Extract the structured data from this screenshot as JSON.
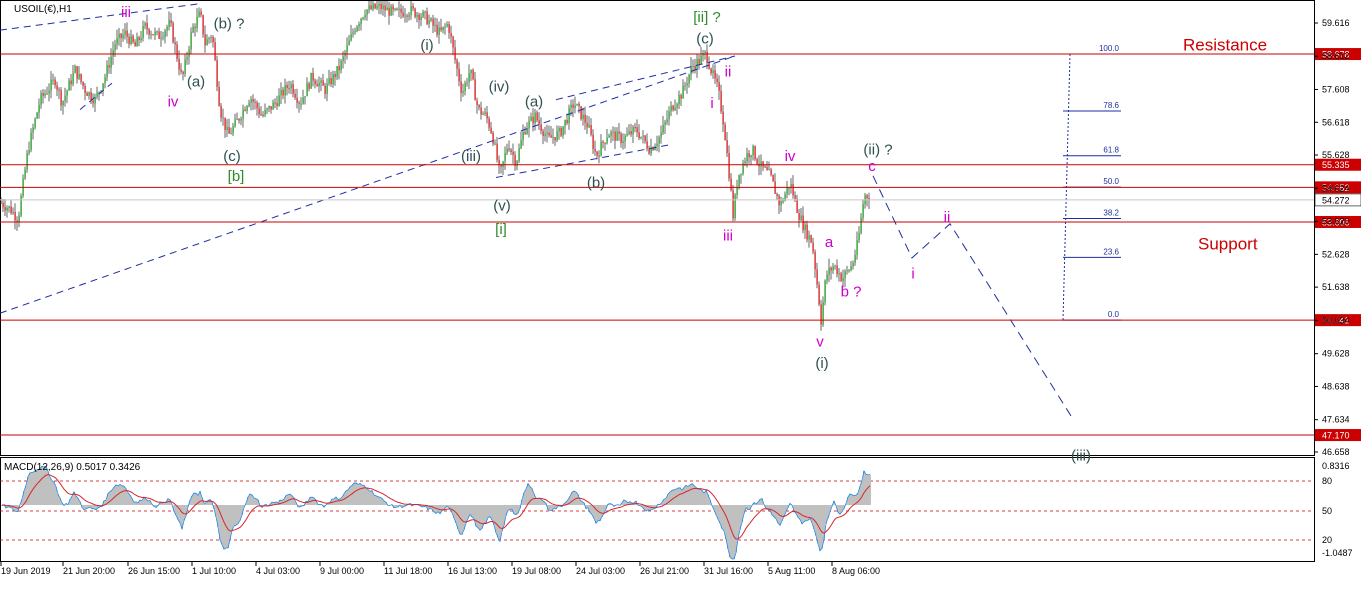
{
  "chart_data": {
    "type": "candlestick",
    "title": "USOIL(€),H1",
    "symbol": "USOIL",
    "timeframe": "H1",
    "price_axis": {
      "ylim": [
        46.658,
        60.0
      ],
      "ticks": [
        59.616,
        58.612,
        57.608,
        56.618,
        55.628,
        54.624,
        53.62,
        52.628,
        51.638,
        50.634,
        49.628,
        48.638,
        47.634,
        46.658
      ]
    },
    "time_axis": {
      "labels": [
        "19 Jun 2019",
        "21 Jun 20:00",
        "26 Jun 15:00",
        "1 Jul 10:00",
        "4 Jul 03:00",
        "9 Jul 00:00",
        "11 Jul 18:00",
        "16 Jul 13:00",
        "19 Jul 08:00",
        "24 Jul 03:00",
        "26 Jul 21:00",
        "31 Jul 16:00",
        "5 Aug 11:00",
        "8 Aug 06:00"
      ]
    },
    "horizontal_levels": [
      {
        "price": 58.678,
        "label": "58.678"
      },
      {
        "price": 55.335,
        "label": "55.335"
      },
      {
        "price": 54.652,
        "label": "54.652"
      },
      {
        "price": 53.606,
        "label": "53.606"
      },
      {
        "price": 50.641,
        "label": "50.641"
      },
      {
        "price": 47.17,
        "label": "47.170"
      }
    ],
    "current_price": {
      "price": 54.272,
      "label": "54.272"
    },
    "zone_labels": [
      {
        "text": "Resistance",
        "price": 58.9
      },
      {
        "text": "Support",
        "price": 52.9
      }
    ],
    "fibonacci": {
      "high": 58.678,
      "low": 50.641,
      "levels": [
        {
          "ratio": 100.0,
          "label": "100.0"
        },
        {
          "ratio": 78.6,
          "label": "78.6"
        },
        {
          "ratio": 61.8,
          "label": "61.8"
        },
        {
          "ratio": 50.0,
          "label": "50.0"
        },
        {
          "ratio": 38.2,
          "label": "38.2"
        },
        {
          "ratio": 23.6,
          "label": "23.6"
        },
        {
          "ratio": 0.0,
          "label": "0.0"
        }
      ]
    },
    "price_path": [
      [
        0,
        54.2
      ],
      [
        10,
        54.0
      ],
      [
        18,
        53.7
      ],
      [
        28,
        55.8
      ],
      [
        40,
        57.3
      ],
      [
        55,
        57.9
      ],
      [
        62,
        57.2
      ],
      [
        75,
        58.2
      ],
      [
        85,
        57.6
      ],
      [
        95,
        57.3
      ],
      [
        105,
        58.0
      ],
      [
        115,
        59.0
      ],
      [
        125,
        59.3
      ],
      [
        135,
        58.9
      ],
      [
        145,
        59.5
      ],
      [
        158,
        59.2
      ],
      [
        170,
        59.6
      ],
      [
        182,
        57.9
      ],
      [
        192,
        59.4
      ],
      [
        200,
        59.9
      ],
      [
        205,
        59.0
      ],
      [
        212,
        59.3
      ],
      [
        220,
        57.0
      ],
      [
        228,
        56.2
      ],
      [
        238,
        56.7
      ],
      [
        250,
        57.4
      ],
      [
        262,
        56.8
      ],
      [
        275,
        57.2
      ],
      [
        290,
        57.8
      ],
      [
        300,
        57.2
      ],
      [
        312,
        58.0
      ],
      [
        325,
        57.6
      ],
      [
        340,
        58.3
      ],
      [
        355,
        59.5
      ],
      [
        365,
        60.0
      ],
      [
        380,
        60.1
      ],
      [
        395,
        59.9
      ],
      [
        410,
        60.0
      ],
      [
        425,
        59.8
      ],
      [
        440,
        59.3
      ],
      [
        448,
        59.6
      ],
      [
        455,
        58.5
      ],
      [
        462,
        57.5
      ],
      [
        470,
        58.2
      ],
      [
        478,
        57.0
      ],
      [
        486,
        56.8
      ],
      [
        492,
        56.3
      ],
      [
        500,
        55.0
      ],
      [
        508,
        56.0
      ],
      [
        516,
        55.4
      ],
      [
        524,
        56.4
      ],
      [
        535,
        56.8
      ],
      [
        548,
        56.1
      ],
      [
        560,
        56.3
      ],
      [
        574,
        57.2
      ],
      [
        588,
        56.5
      ],
      [
        596,
        55.6
      ],
      [
        608,
        56.3
      ],
      [
        622,
        56.1
      ],
      [
        636,
        56.4
      ],
      [
        650,
        55.8
      ],
      [
        660,
        56.2
      ],
      [
        672,
        57.1
      ],
      [
        682,
        57.5
      ],
      [
        692,
        58.3
      ],
      [
        700,
        58.5
      ],
      [
        706,
        58.7
      ],
      [
        712,
        58.1
      ],
      [
        718,
        57.6
      ],
      [
        724,
        56.5
      ],
      [
        730,
        54.8
      ],
      [
        733,
        53.8
      ],
      [
        738,
        55.0
      ],
      [
        746,
        55.6
      ],
      [
        752,
        55.8
      ],
      [
        760,
        55.3
      ],
      [
        770,
        55.0
      ],
      [
        780,
        54.1
      ],
      [
        790,
        54.8
      ],
      [
        798,
        53.9
      ],
      [
        806,
        53.3
      ],
      [
        812,
        53.0
      ],
      [
        818,
        51.5
      ],
      [
        821,
        50.641
      ],
      [
        826,
        52.0
      ],
      [
        834,
        52.3
      ],
      [
        842,
        51.9
      ],
      [
        852,
        52.3
      ],
      [
        858,
        53.0
      ],
      [
        864,
        54.4
      ],
      [
        870,
        54.4
      ]
    ],
    "wave_labels": [
      {
        "text": "iii",
        "x": 126,
        "price": 59.95,
        "color": "#cc00cc"
      },
      {
        "text": "iv",
        "x": 173,
        "price": 57.25,
        "color": "#cc00cc"
      },
      {
        "text": "(a)",
        "x": 196,
        "price": 57.85,
        "color": "#2f4f4f"
      },
      {
        "text": "(b) ?",
        "x": 229,
        "price": 59.6,
        "color": "#2f4f4f"
      },
      {
        "text": "(c)",
        "x": 232,
        "price": 55.6,
        "color": "#2f4f4f"
      },
      {
        "text": "[b]",
        "x": 236,
        "price": 55.0,
        "color": "#2e8b2e"
      },
      {
        "text": "(i)",
        "x": 427,
        "price": 58.95,
        "color": "#2f4f4f"
      },
      {
        "text": "(iv)",
        "x": 499,
        "price": 57.7,
        "color": "#2f4f4f"
      },
      {
        "text": "(a)",
        "x": 534,
        "price": 57.25,
        "color": "#2f4f4f"
      },
      {
        "text": "(iii)",
        "x": 471,
        "price": 55.6,
        "color": "#2f4f4f"
      },
      {
        "text": "(b)",
        "x": 596,
        "price": 54.8,
        "color": "#2f4f4f"
      },
      {
        "text": "(v)",
        "x": 502,
        "price": 54.1,
        "color": "#2f4f4f"
      },
      {
        "text": "[i]",
        "x": 501,
        "price": 53.4,
        "color": "#2e8b2e"
      },
      {
        "text": "[ii] ?",
        "x": 707,
        "price": 59.8,
        "color": "#2e8b2e"
      },
      {
        "text": "(c)",
        "x": 705,
        "price": 59.15,
        "color": "#2f4f4f"
      },
      {
        "text": "ii",
        "x": 728,
        "price": 58.15,
        "color": "#cc00cc"
      },
      {
        "text": "i",
        "x": 712,
        "price": 57.2,
        "color": "#cc00cc"
      },
      {
        "text": "iv",
        "x": 790,
        "price": 55.6,
        "color": "#cc00cc"
      },
      {
        "text": "(ii) ?",
        "x": 878,
        "price": 55.8,
        "color": "#2f4f4f"
      },
      {
        "text": "c",
        "x": 872,
        "price": 55.3,
        "color": "#cc00cc"
      },
      {
        "text": "iii",
        "x": 728,
        "price": 53.2,
        "color": "#cc00cc"
      },
      {
        "text": "a",
        "x": 829,
        "price": 53.0,
        "color": "#cc00cc"
      },
      {
        "text": "b ?",
        "x": 851,
        "price": 51.5,
        "color": "#cc00cc"
      },
      {
        "text": "ii",
        "x": 947,
        "price": 53.75,
        "color": "#cc00cc"
      },
      {
        "text": "i",
        "x": 913,
        "price": 52.05,
        "color": "#cc00cc"
      },
      {
        "text": "v",
        "x": 820,
        "price": 50.0,
        "color": "#cc00cc"
      },
      {
        "text": "(i)",
        "x": 822,
        "price": 49.35,
        "color": "#2f4f4f"
      },
      {
        "text": "(iii)",
        "x": 1081,
        "price": 46.55,
        "color": "#2f4f4f"
      }
    ],
    "projection_path": [
      [
        873,
        55.0
      ],
      [
        912,
        52.52
      ],
      [
        950,
        53.55
      ],
      [
        1071,
        47.75
      ]
    ],
    "trendlines": [
      {
        "from": [
          0,
          59.4
        ],
        "to": [
          200,
          60.2
        ]
      },
      {
        "from": [
          0,
          50.85
        ],
        "to": [
          735,
          58.62
        ]
      },
      {
        "from": [
          556,
          57.3
        ],
        "to": [
          735,
          58.62
        ]
      },
      {
        "from": [
          496,
          54.95
        ],
        "to": [
          672,
          55.95
        ]
      },
      {
        "from": [
          80,
          57.0
        ],
        "to": [
          112,
          57.8
        ]
      }
    ],
    "macd": {
      "label": "MACD(12,26,9) 0.5017 0.3426",
      "ylim": [
        -1.0487,
        0.8316
      ],
      "ticks": [
        "0.8316",
        "80",
        "50",
        "20",
        "-1.0487"
      ],
      "reference_lines": [
        80,
        50,
        20
      ]
    }
  }
}
